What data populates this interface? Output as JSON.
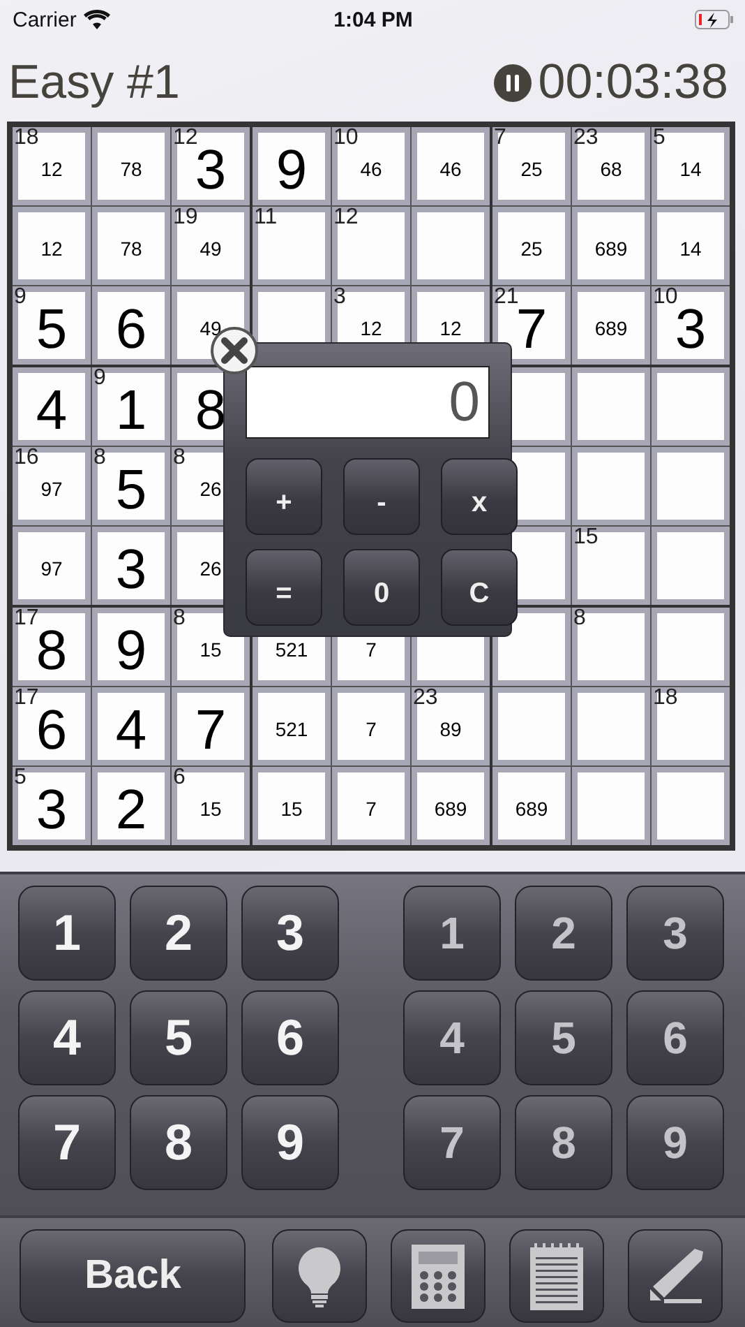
{
  "status_bar": {
    "carrier": "Carrier",
    "time": "1:04 PM"
  },
  "header": {
    "title": "Easy #1",
    "timer": "00:03:38"
  },
  "grid": {
    "rows": [
      [
        {
          "cage": "18",
          "notes": "12"
        },
        {
          "notes": "78"
        },
        {
          "cage": "12",
          "value": "3"
        },
        {
          "value": "9"
        },
        {
          "cage": "10",
          "notes": "46"
        },
        {
          "notes": "46"
        },
        {
          "cage": "7",
          "notes": "25"
        },
        {
          "cage": "23",
          "notes": "68"
        },
        {
          "cage": "5",
          "notes": "14"
        }
      ],
      [
        {
          "notes": "12"
        },
        {
          "notes": "78"
        },
        {
          "cage": "19",
          "notes": "49"
        },
        {
          "cage": "11"
        },
        {
          "cage": "12"
        },
        {},
        {
          "notes": "25"
        },
        {
          "notes": "689"
        },
        {
          "notes": "14"
        }
      ],
      [
        {
          "cage": "9",
          "value": "5"
        },
        {
          "value": "6"
        },
        {
          "notes": "49"
        },
        {},
        {
          "cage": "3",
          "notes": "12"
        },
        {
          "notes": "12"
        },
        {
          "cage": "21",
          "value": "7"
        },
        {
          "notes": "689"
        },
        {
          "cage": "10",
          "value": "3"
        }
      ],
      [
        {
          "value": "4"
        },
        {
          "cage": "9",
          "value": "1"
        },
        {
          "value": "8"
        },
        null,
        null,
        null,
        {},
        {},
        {}
      ],
      [
        {
          "cage": "16",
          "notes": "97"
        },
        {
          "cage": "8",
          "value": "5"
        },
        {
          "cage": "8",
          "notes": "26"
        },
        null,
        null,
        null,
        {},
        {},
        {}
      ],
      [
        {
          "notes": "97"
        },
        {
          "value": "3"
        },
        {
          "notes": "26"
        },
        null,
        null,
        null,
        {},
        {
          "cage": "15"
        },
        {}
      ],
      [
        {
          "cage": "17",
          "value": "8"
        },
        {
          "value": "9"
        },
        {
          "cage": "8",
          "notes": "15"
        },
        {
          "notes": "521"
        },
        {
          "notes": "7"
        },
        {},
        {},
        {
          "cage": "8"
        },
        {}
      ],
      [
        {
          "cage": "17",
          "value": "6"
        },
        {
          "value": "4"
        },
        {
          "value": "7"
        },
        {
          "notes": "521"
        },
        {
          "notes": "7"
        },
        {
          "cage": "23",
          "notes": "89"
        },
        {},
        {},
        {
          "cage": "18"
        }
      ],
      [
        {
          "cage": "5",
          "value": "3"
        },
        {
          "value": "2"
        },
        {
          "cage": "6",
          "notes": "15"
        },
        {
          "notes": "15"
        },
        {
          "notes": "7"
        },
        {
          "notes": "689"
        },
        {
          "notes": "689"
        },
        {},
        {}
      ]
    ]
  },
  "calculator": {
    "display": "0",
    "keys": [
      "+",
      "-",
      "x",
      "=",
      "0",
      "C"
    ]
  },
  "keypads": [
    {
      "kind": "value",
      "keys": [
        "1",
        "2",
        "3",
        "4",
        "5",
        "6",
        "7",
        "8",
        "9"
      ]
    },
    {
      "kind": "note",
      "keys": [
        "1",
        "2",
        "3",
        "4",
        "5",
        "6",
        "7",
        "8",
        "9"
      ]
    }
  ],
  "toolbar": {
    "back": "Back",
    "tools": [
      {
        "kind": "hint"
      },
      {
        "kind": "calculator"
      },
      {
        "kind": "notes"
      },
      {
        "kind": "pencil"
      }
    ]
  }
}
